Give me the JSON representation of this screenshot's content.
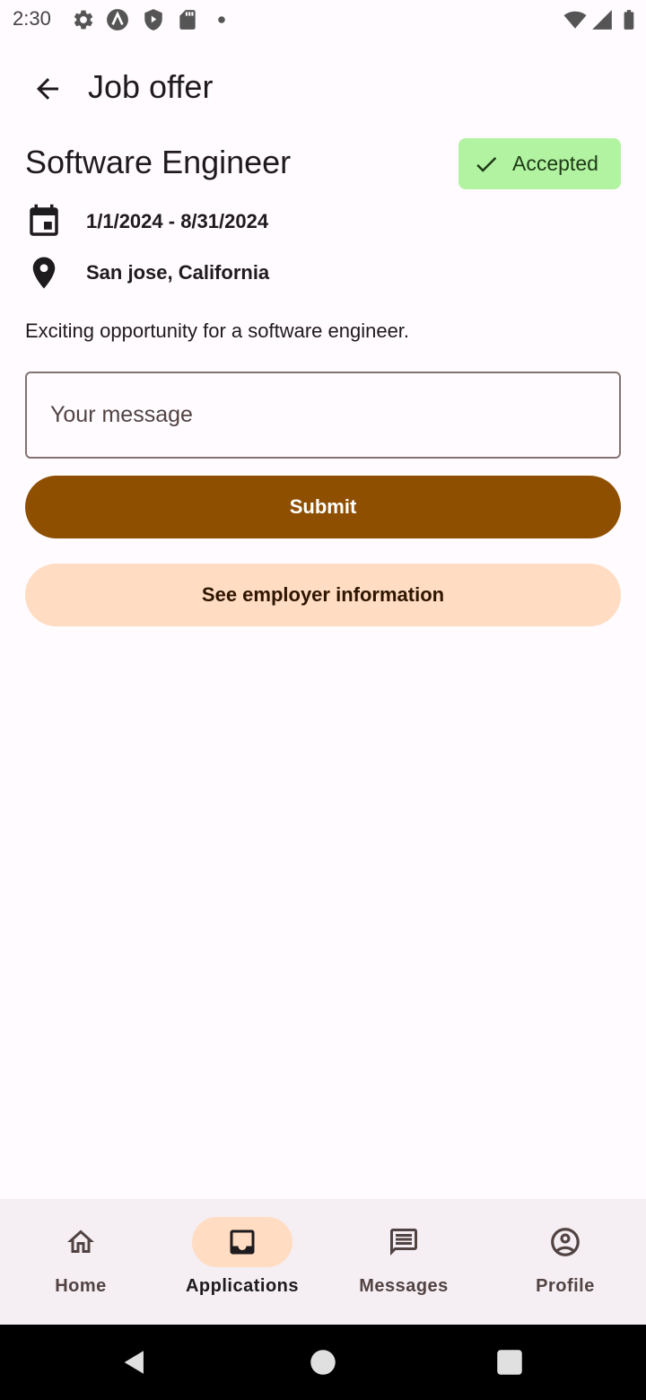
{
  "status_bar": {
    "time": "2:30",
    "icons": [
      "settings-icon",
      "app-a-icon",
      "shield-icon",
      "sd-card-icon",
      "dot-icon",
      "wifi-icon",
      "signal-icon",
      "battery-icon"
    ]
  },
  "app_bar": {
    "back_icon": "arrow-back-icon",
    "title": "Job offer"
  },
  "job": {
    "title": "Software Engineer",
    "status": "Accepted",
    "status_icon": "check-icon",
    "status_color": "#b2f3a2",
    "dates": "1/1/2024 - 8/31/2024",
    "date_icon": "calendar-icon",
    "location": "San jose, California",
    "location_icon": "location-pin-icon",
    "description": "Exciting opportunity for a software engineer."
  },
  "message": {
    "placeholder": "Your message",
    "value": ""
  },
  "buttons": {
    "submit": "Submit",
    "employer": "See employer information"
  },
  "colors": {
    "primary": "#8f4f00",
    "secondary_container": "#ffdcc2",
    "background": "#fffbfe"
  },
  "bottom_nav": {
    "items": [
      {
        "label": "Home",
        "icon": "home-icon",
        "active": false
      },
      {
        "label": "Applications",
        "icon": "inbox-icon",
        "active": true
      },
      {
        "label": "Messages",
        "icon": "message-icon",
        "active": false
      },
      {
        "label": "Profile",
        "icon": "account-circle-icon",
        "active": false
      }
    ]
  },
  "system_nav": [
    "back-triangle-icon",
    "home-circle-icon",
    "recents-square-icon"
  ]
}
